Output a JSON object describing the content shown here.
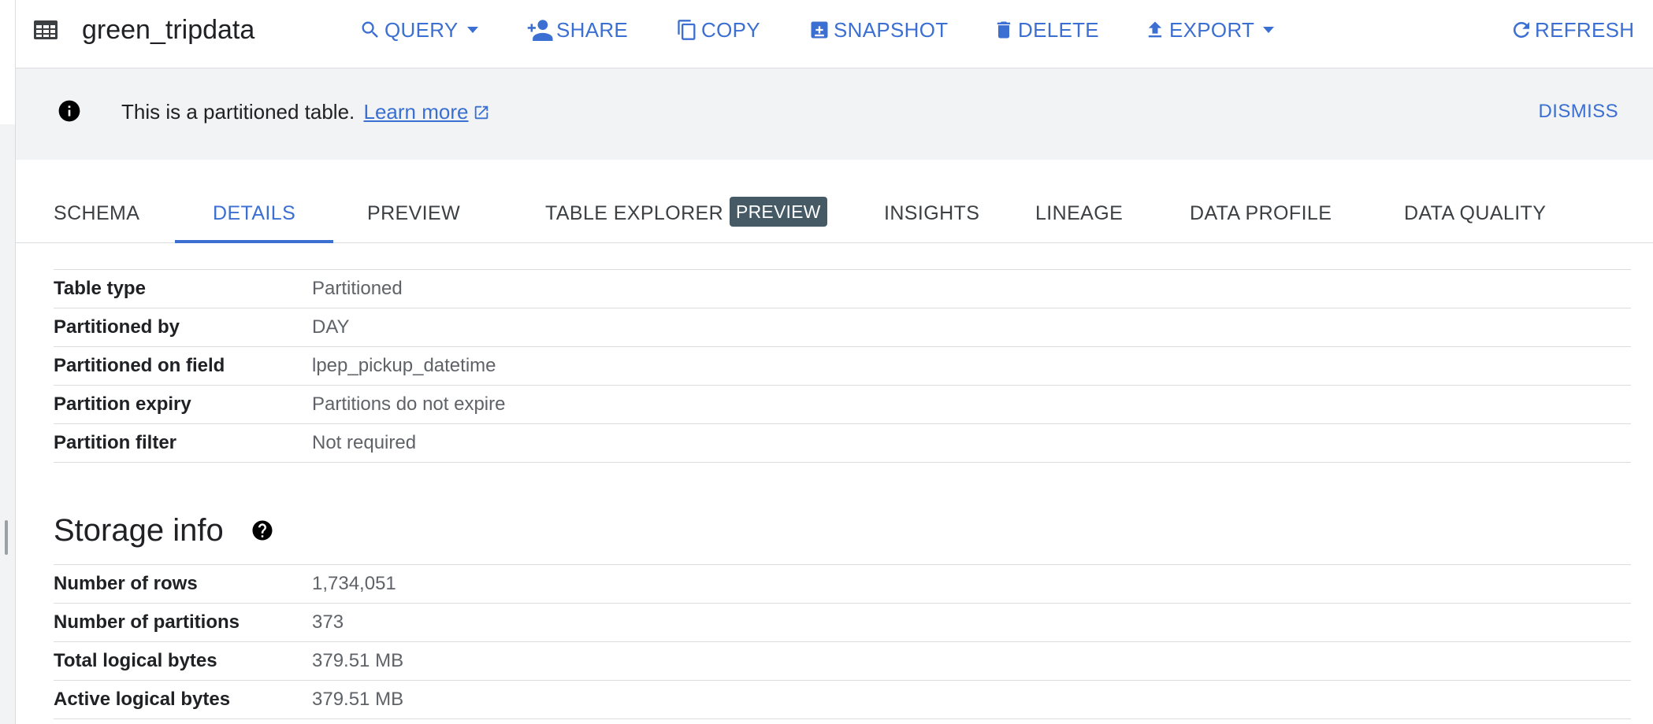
{
  "toolbar": {
    "table_name": "green_tripdata",
    "actions": {
      "query": "QUERY",
      "share": "SHARE",
      "copy": "COPY",
      "snapshot": "SNAPSHOT",
      "delete": "DELETE",
      "export": "EXPORT",
      "refresh": "REFRESH"
    }
  },
  "banner": {
    "text": "This is a partitioned table.",
    "link": "Learn more",
    "dismiss": "DISMISS"
  },
  "tabs": {
    "schema": "SCHEMA",
    "details": "DETAILS",
    "preview": "PREVIEW",
    "table_explorer": "TABLE EXPLORER",
    "table_explorer_badge": "PREVIEW",
    "insights": "INSIGHTS",
    "lineage": "LINEAGE",
    "data_profile": "DATA PROFILE",
    "data_quality": "DATA QUALITY",
    "active": "DETAILS"
  },
  "partition_details": [
    {
      "key": "Table type",
      "value": "Partitioned"
    },
    {
      "key": "Partitioned by",
      "value": "DAY"
    },
    {
      "key": "Partitioned on field",
      "value": "lpep_pickup_datetime"
    },
    {
      "key": "Partition expiry",
      "value": "Partitions do not expire"
    },
    {
      "key": "Partition filter",
      "value": "Not required"
    }
  ],
  "storage_info": {
    "title": "Storage info",
    "rows": [
      {
        "key": "Number of rows",
        "value": "1,734,051"
      },
      {
        "key": "Number of partitions",
        "value": "373"
      },
      {
        "key": "Total logical bytes",
        "value": "379.51 MB"
      },
      {
        "key": "Active logical bytes",
        "value": "379.51 MB"
      }
    ]
  },
  "colors": {
    "accent": "#3b6fd1",
    "banner_bg": "#f1f3f4",
    "badge_bg": "#455a64",
    "divider": "#dadce0"
  },
  "icons": [
    "table-icon",
    "search-icon",
    "person-add-icon",
    "copy-icon",
    "snapshot-icon",
    "delete-icon",
    "export-icon",
    "refresh-icon",
    "info-icon",
    "external-link-icon",
    "help-icon"
  ]
}
